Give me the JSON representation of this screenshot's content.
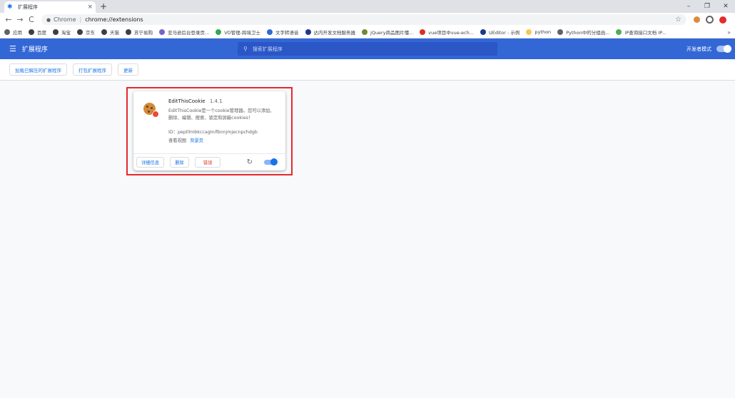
{
  "tab": {
    "title": "扩展程序",
    "close": "×",
    "new": "+"
  },
  "window_controls": [
    "–",
    "❐",
    "✕"
  ],
  "nav": {
    "back": "←",
    "forward": "→",
    "reload": "C"
  },
  "omnibox": {
    "chip": "Chrome",
    "url": "chrome://extensions",
    "star": "☆"
  },
  "bookmarks": {
    "items": [
      {
        "label": "应用",
        "color": "#5f6368"
      },
      {
        "label": "百度",
        "color": "#3c4043"
      },
      {
        "label": "淘宝",
        "color": "#3c4043"
      },
      {
        "label": "京东",
        "color": "#3c4043"
      },
      {
        "label": "天猫",
        "color": "#3c4043"
      },
      {
        "label": "苏宁易购",
        "color": "#3c4043"
      },
      {
        "label": "亚马逊后台登录页...",
        "color": "#7b61c9"
      },
      {
        "label": "VD管理-跨境卫士",
        "color": "#34a853"
      },
      {
        "label": "文字转语音",
        "color": "#3367d6"
      },
      {
        "label": "达内开发文档服务器",
        "color": "#1a3a8c"
      },
      {
        "label": "jQuery商品图片懂...",
        "color": "#6d8c2f"
      },
      {
        "label": "vue项目中vue-ech...",
        "color": "#d93025"
      },
      {
        "label": "UEditor - 示例",
        "color": "#1a3a8c"
      },
      {
        "label": "python",
        "color": "#f9c74f"
      },
      {
        "label": "Python中的分组函...",
        "color": "#5f6368"
      },
      {
        "label": "IP查询接口文档 IP...",
        "color": "#4caf50"
      }
    ],
    "more": "»"
  },
  "header": {
    "title": "扩展程序",
    "search_placeholder": "搜索扩展程序",
    "devmode_label": "开发者模式"
  },
  "toolbar": {
    "load_unpacked": "加载已解压的扩展程序",
    "pack": "打包扩展程序",
    "update": "更新"
  },
  "extension": {
    "name": "EditThisCookie",
    "version": "1.4.1",
    "description": "EditThisCookie是一个cookie管理器。您可以添加、删除、编辑、搜索、锁定和屏蔽cookies！",
    "id_label": "ID：",
    "id": "peplllmbkccagInifbnnjmjecnpchdgb",
    "view_label": "查看视图",
    "view_link": "背景页",
    "details": "详细信息",
    "remove": "删除",
    "errors": "错误",
    "enabled": true
  }
}
